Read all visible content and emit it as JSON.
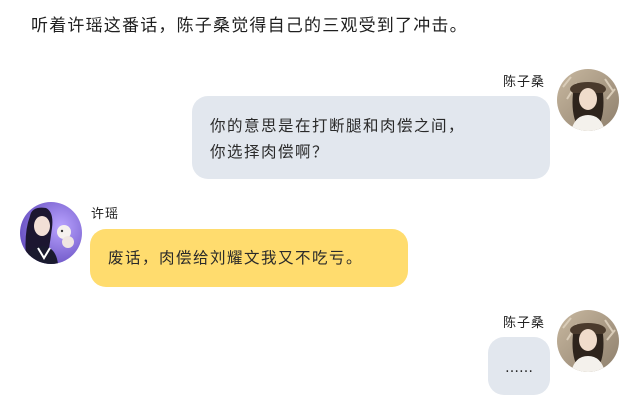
{
  "narration": "听着许瑶这番话，陈子桑觉得自己的三观受到了冲击。",
  "messages": [
    {
      "sender": "陈子桑",
      "side": "right",
      "bubble_color": "#e2e7ee",
      "lines": [
        "你的意思是在打断腿和肉偿之间，",
        "你选择肉偿啊？"
      ]
    },
    {
      "sender": "许瑶",
      "side": "left",
      "bubble_color": "#ffdc6e",
      "lines": [
        "废话，肉偿给刘耀文我又不吃亏。"
      ]
    },
    {
      "sender": "陈子桑",
      "side": "right",
      "bubble_color": "#e2e7ee",
      "lines": [
        "……"
      ]
    }
  ]
}
